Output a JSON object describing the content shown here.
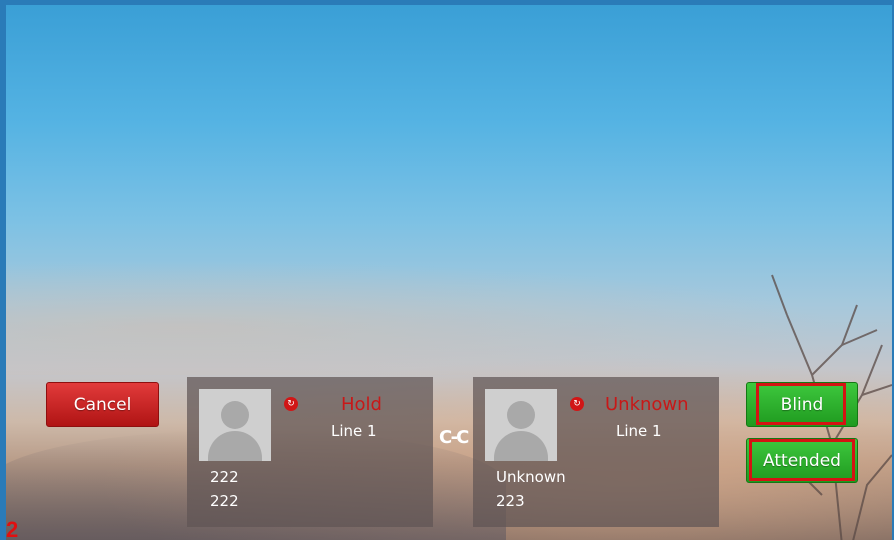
{
  "cancel_label": "Cancel",
  "blind_label": "Blind",
  "attended_label": "Attended",
  "transfer_icon_glyph": "C-C",
  "page_number": "2",
  "accent_red": "#d41313",
  "button_green": "#2fb12f",
  "calls": [
    {
      "status": "Hold",
      "line": "Line 1",
      "name": "222",
      "number": "222",
      "icon": "avatar-icon"
    },
    {
      "status": "Unknown",
      "line": "Line 1",
      "name": "Unknown",
      "number": "223",
      "icon": "avatar-icon"
    }
  ]
}
